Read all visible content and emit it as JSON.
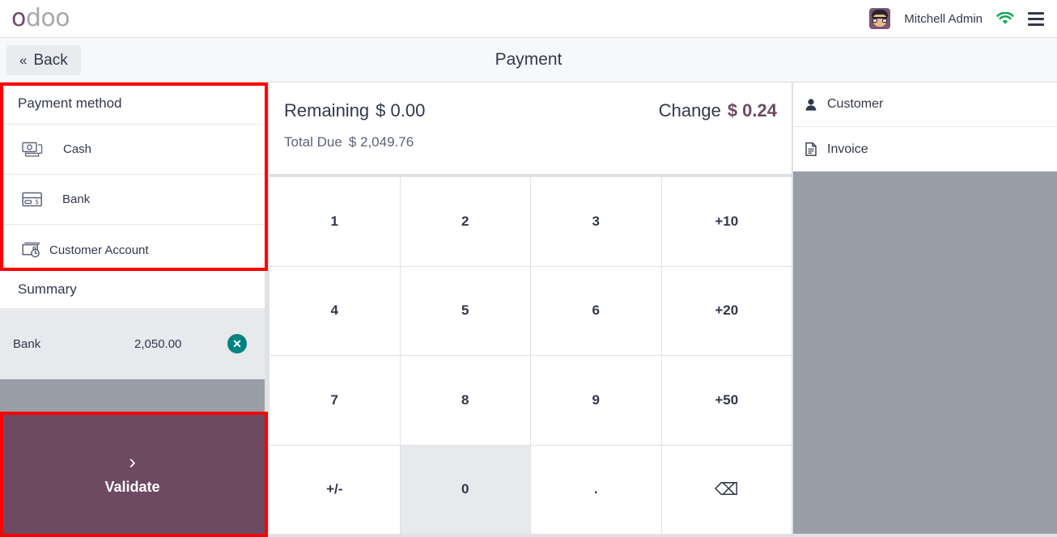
{
  "header": {
    "logo_primary": "o",
    "logo_rest": "doo",
    "username": "Mitchell Admin",
    "wifi_icon": "wifi-icon",
    "menu_icon": "hamburger-menu-icon",
    "avatar_icon": "user-avatar"
  },
  "subheader": {
    "back_label": "Back",
    "back_chevron": "«",
    "page_title": "Payment"
  },
  "payment_methods": {
    "panel_title": "Payment method",
    "items": [
      {
        "label": "Cash",
        "icon": "cash-icon"
      },
      {
        "label": "Bank",
        "icon": "credit-card-icon"
      },
      {
        "label": "Customer Account",
        "icon": "customer-account-icon"
      }
    ]
  },
  "summary": {
    "panel_title": "Summary",
    "lines": [
      {
        "name": "Bank",
        "amount": "2,050.00",
        "delete_icon": "delete-circle-icon"
      }
    ]
  },
  "validate": {
    "chevron": "›",
    "label": "Validate"
  },
  "totals": {
    "remaining_label": "Remaining",
    "remaining_value": "$ 0.00",
    "change_label": "Change",
    "change_value": "$ 0.24",
    "total_due_label": "Total Due",
    "total_due_value": "$ 2,049.76"
  },
  "numpad": {
    "keys": [
      {
        "label": "1",
        "name": "numpad-1",
        "active": false
      },
      {
        "label": "2",
        "name": "numpad-2",
        "active": false
      },
      {
        "label": "3",
        "name": "numpad-3",
        "active": false
      },
      {
        "label": "+10",
        "name": "numpad-plus-10",
        "active": false
      },
      {
        "label": "4",
        "name": "numpad-4",
        "active": false
      },
      {
        "label": "5",
        "name": "numpad-5",
        "active": false
      },
      {
        "label": "6",
        "name": "numpad-6",
        "active": false
      },
      {
        "label": "+20",
        "name": "numpad-plus-20",
        "active": false
      },
      {
        "label": "7",
        "name": "numpad-7",
        "active": false
      },
      {
        "label": "8",
        "name": "numpad-8",
        "active": false
      },
      {
        "label": "9",
        "name": "numpad-9",
        "active": false
      },
      {
        "label": "+50",
        "name": "numpad-plus-50",
        "active": false
      },
      {
        "label": "+/-",
        "name": "numpad-sign-toggle",
        "active": false
      },
      {
        "label": "0",
        "name": "numpad-0",
        "active": true
      },
      {
        "label": ".",
        "name": "numpad-decimal",
        "active": false
      },
      {
        "label": "⌫",
        "name": "numpad-backspace",
        "active": false
      }
    ]
  },
  "right_panel": {
    "items": [
      {
        "label": "Customer",
        "icon": "person-icon"
      },
      {
        "label": "Invoice",
        "icon": "document-icon"
      }
    ]
  },
  "colors": {
    "brand_purple": "#714B67",
    "validate_bg": "#6d4a62",
    "highlight_red": "#ff0000",
    "change_accent": "#6d4a62",
    "delete_teal": "#00837f",
    "wifi_green": "#00a651",
    "panel_gray": "#9a9ea6"
  }
}
